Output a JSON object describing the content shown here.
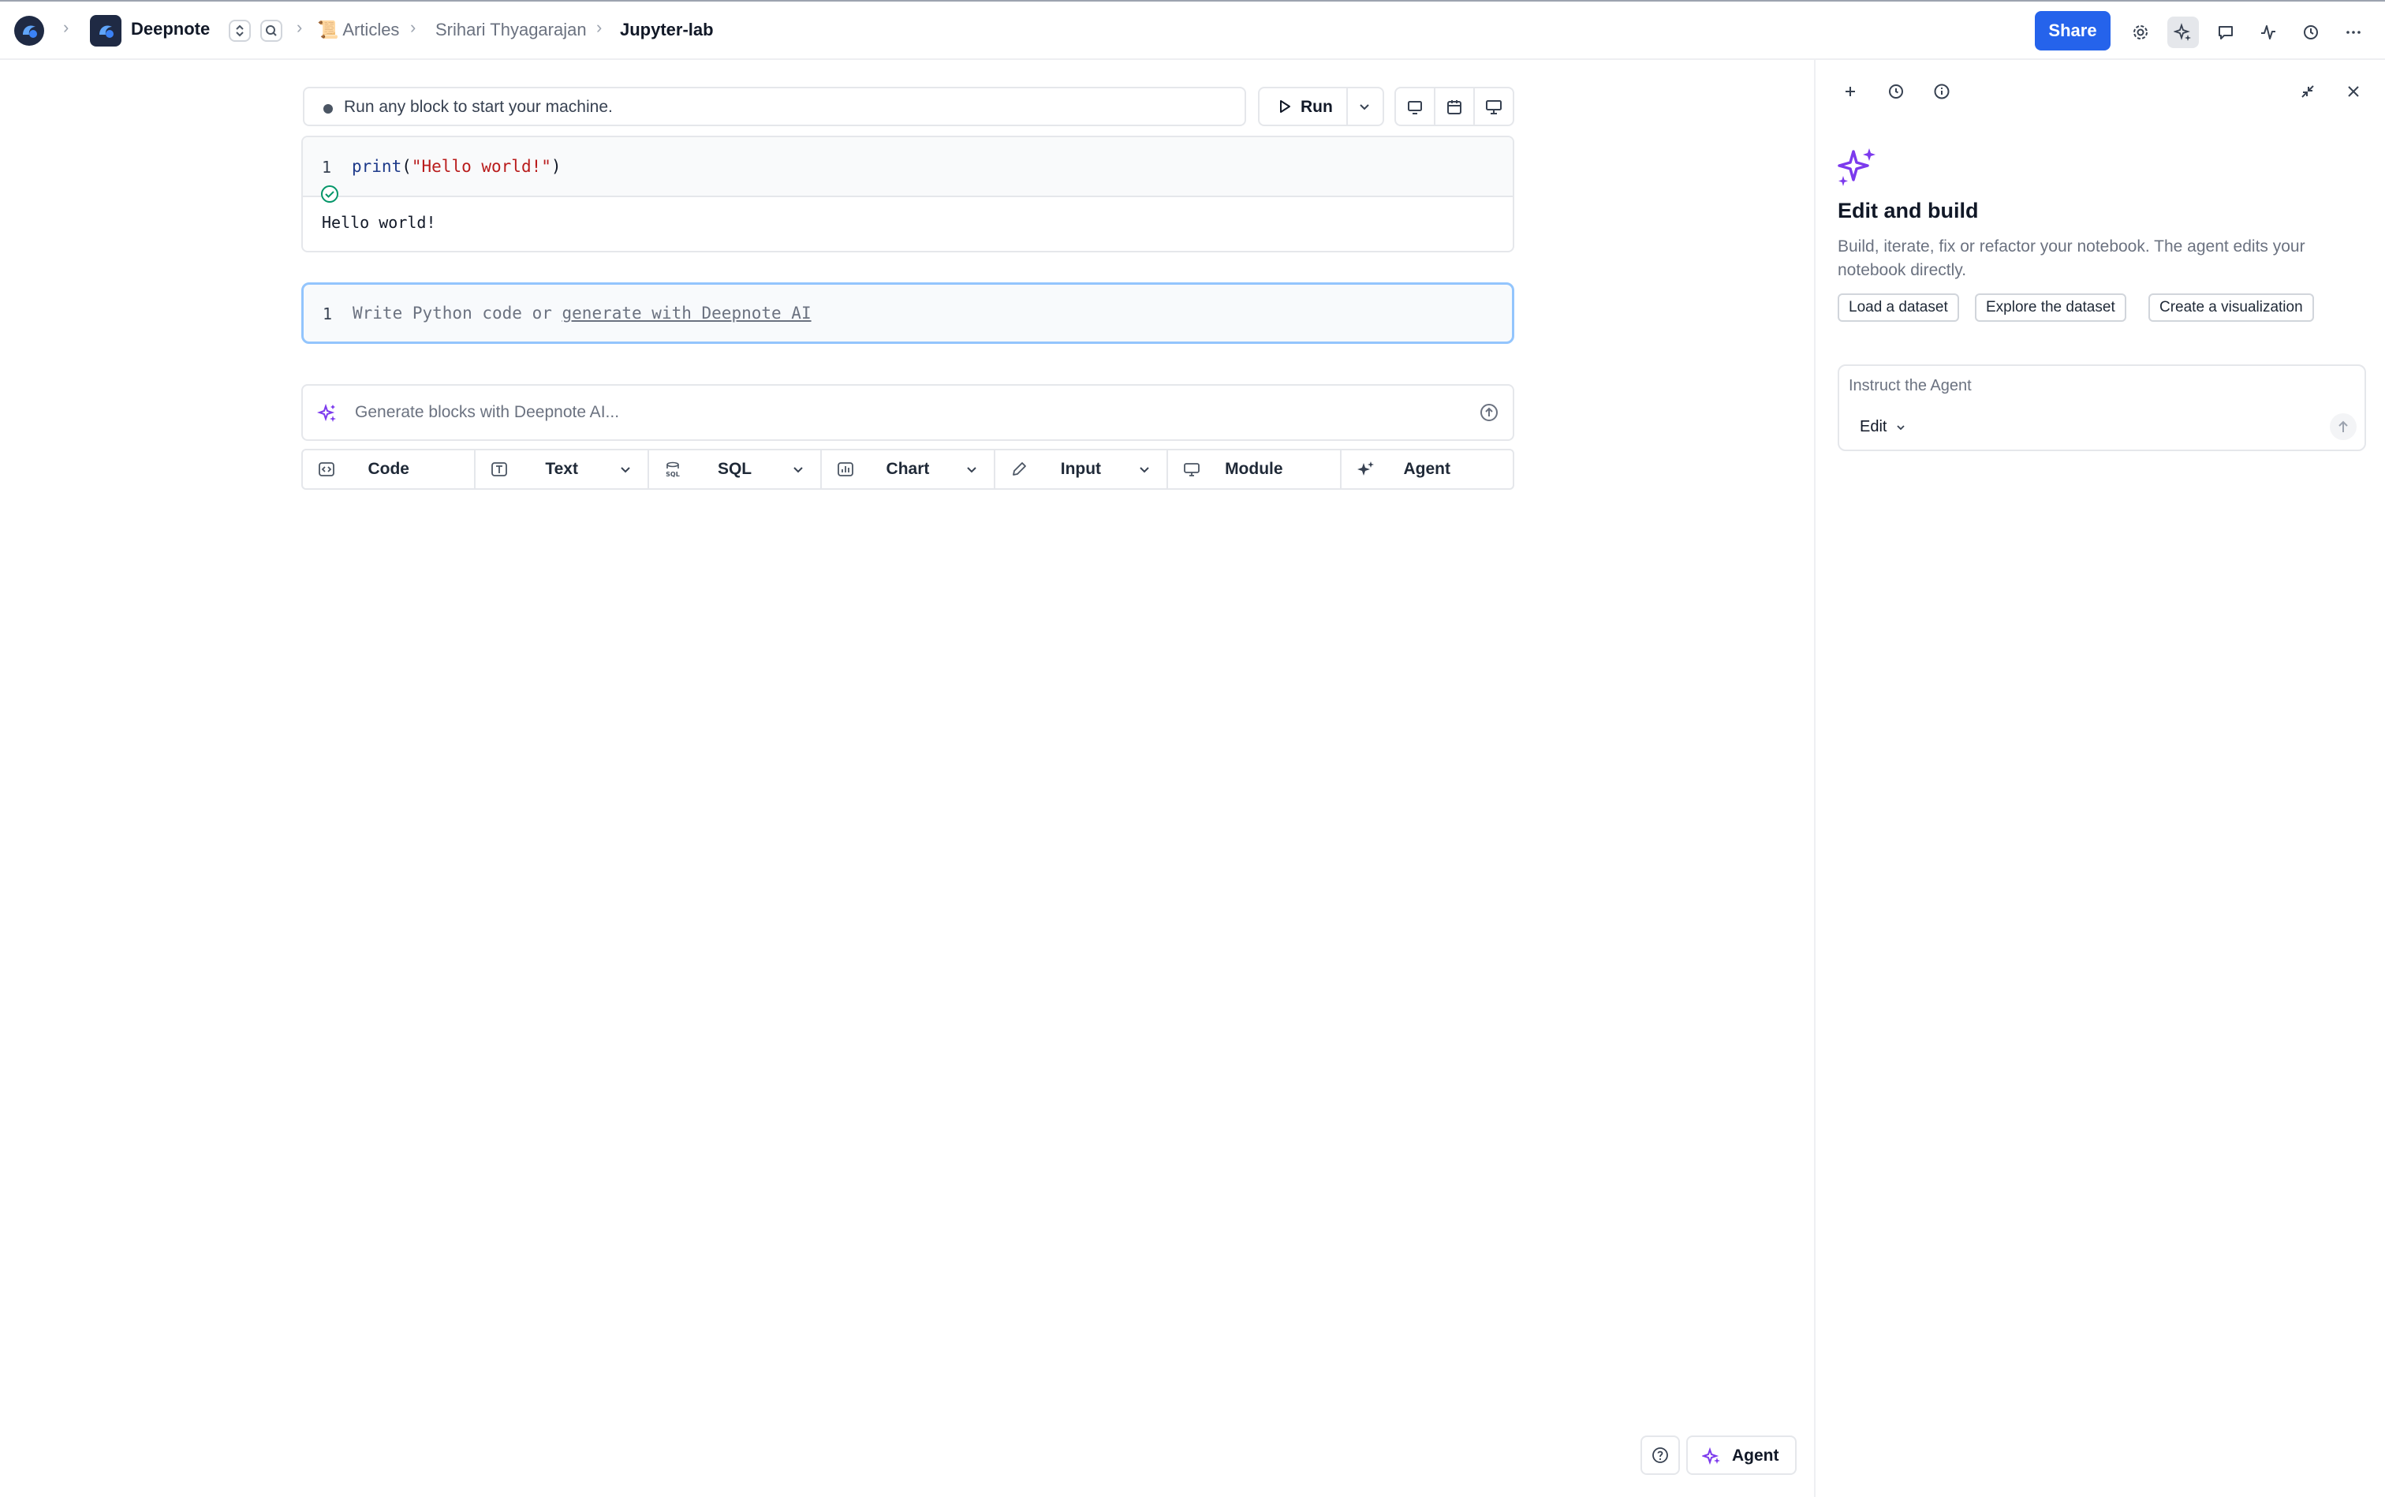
{
  "topbar": {
    "workspace_name": "Deepnote",
    "breadcrumbs": [
      {
        "label": "Articles",
        "emoji": "📜"
      },
      {
        "label": "Srihari Thyagarajan"
      },
      {
        "label": "Jupyter-lab"
      }
    ],
    "share_label": "Share",
    "colors": {
      "share": "#2563eb",
      "logo": "#1f2a44"
    }
  },
  "notebook": {
    "status_text": "Run any block to start your machine.",
    "run_label": "Run",
    "cells": [
      {
        "line_number": "1",
        "code_fn": "print",
        "code_open": "(",
        "code_string": "\"Hello world!\"",
        "code_close": ")",
        "output": "Hello world!"
      },
      {
        "line_number": "1",
        "placeholder_prefix": "Write Python code or ",
        "placeholder_link": "generate with Deepnote AI"
      }
    ],
    "ai_placeholder": "Generate blocks with Deepnote AI...",
    "block_types": [
      {
        "label": "Code",
        "icon": "code-icon",
        "dropdown": false
      },
      {
        "label": "Text",
        "icon": "text-icon",
        "dropdown": true
      },
      {
        "label": "SQL",
        "icon": "sql-icon",
        "dropdown": true
      },
      {
        "label": "Chart",
        "icon": "chart-icon",
        "dropdown": true
      },
      {
        "label": "Input",
        "icon": "pencil-icon",
        "dropdown": true
      },
      {
        "label": "Module",
        "icon": "module-icon",
        "dropdown": false
      },
      {
        "label": "Agent",
        "icon": "sparkle-icon",
        "dropdown": false
      }
    ]
  },
  "floating": {
    "agent_label": "Agent"
  },
  "agent_panel": {
    "title": "Edit and build",
    "description": "Build, iterate, fix or refactor your notebook. The agent edits your notebook directly.",
    "suggestions": [
      "Load a dataset",
      "Explore the dataset",
      "Create a visualization"
    ],
    "input_placeholder": "Instruct the Agent",
    "mode_label": "Edit",
    "accent": "#7c3aed"
  }
}
